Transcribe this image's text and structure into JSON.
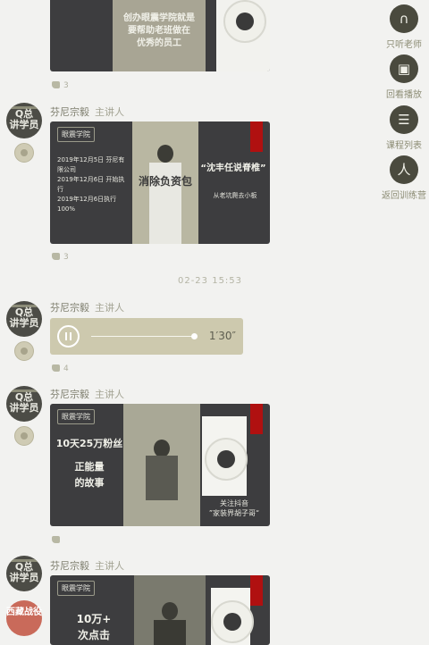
{
  "messages": [
    {
      "sender": "芬尼宗毅",
      "role": "主讲人",
      "card_text": [
        "创办眼震学院就是",
        "要帮助老班做在",
        "优秀的员工"
      ],
      "likes": "3"
    },
    {
      "sender": "芬尼宗毅",
      "role": "主讲人",
      "card_left": [
        "2019年12月5日 芬尼有限公司",
        "2019年12月6日 开始执行",
        "2019年12月6日执行100%"
      ],
      "card_overlay": "消除负资包",
      "card_right_title": "“沈丰任说脊椎”",
      "card_right_sub": "从老坑爬去小板",
      "likes": "3"
    },
    {
      "sender": "芬尼宗毅",
      "role": "主讲人",
      "duration": "1′30″",
      "likes": "4"
    },
    {
      "sender": "芬尼宗毅",
      "role": "主讲人",
      "card_title1": "10天25万粉丝",
      "card_title2": "正能量",
      "card_title3": "的故事",
      "card_right": "关注抖音",
      "card_right2": "”家装界胡子哥“",
      "likes": ""
    },
    {
      "sender": "芬尼宗毅",
      "role": "主讲人",
      "card_title1": "10万+",
      "card_title2": "次点击"
    }
  ],
  "timestamp": "02-23 15:53",
  "logo": "眼震学院",
  "avatar_text": [
    "Q总",
    "讲",
    "学员"
  ],
  "avatar_badge_red": "西藏战役",
  "side_menu": [
    {
      "icon": "headphones-icon",
      "glyph": "∩",
      "label": "只听老师"
    },
    {
      "icon": "replay-icon",
      "glyph": "▣",
      "label": "回看播放"
    },
    {
      "icon": "course-list-icon",
      "glyph": "☰",
      "label": "课程列表"
    },
    {
      "icon": "training-camp-icon",
      "glyph": "人",
      "label": "返回训练营"
    }
  ]
}
